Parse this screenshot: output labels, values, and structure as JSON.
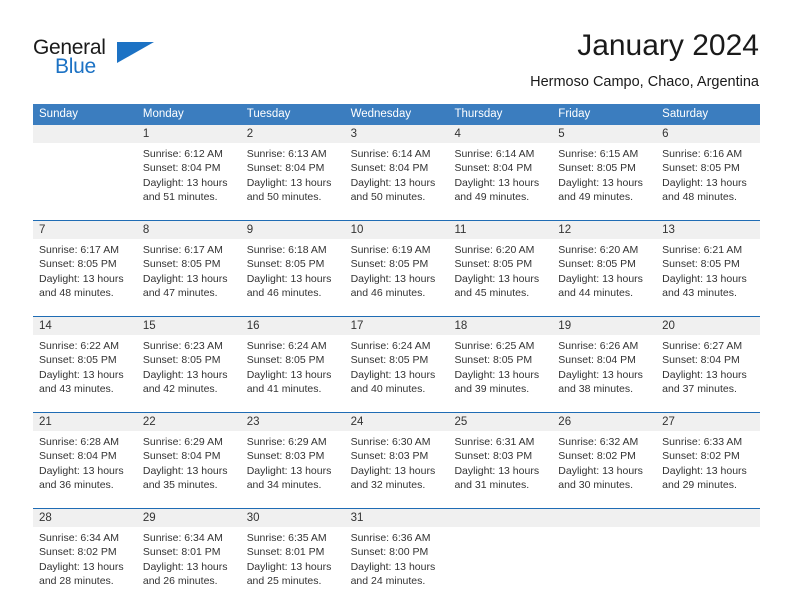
{
  "logo": {
    "word_top": "General",
    "word_bottom": "Blue",
    "accent_color": "#1c72c4"
  },
  "header": {
    "month_title": "January 2024",
    "location": "Hermoso Campo, Chaco, Argentina"
  },
  "calendar": {
    "header_color": "#3b7dbf",
    "day_names": [
      "Sunday",
      "Monday",
      "Tuesday",
      "Wednesday",
      "Thursday",
      "Friday",
      "Saturday"
    ],
    "weeks": [
      [
        {
          "day": "",
          "sunrise": "",
          "sunset": "",
          "daylight_line1": "",
          "daylight_line2": ""
        },
        {
          "day": "1",
          "sunrise": "Sunrise: 6:12 AM",
          "sunset": "Sunset: 8:04 PM",
          "daylight_line1": "Daylight: 13 hours",
          "daylight_line2": "and 51 minutes."
        },
        {
          "day": "2",
          "sunrise": "Sunrise: 6:13 AM",
          "sunset": "Sunset: 8:04 PM",
          "daylight_line1": "Daylight: 13 hours",
          "daylight_line2": "and 50 minutes."
        },
        {
          "day": "3",
          "sunrise": "Sunrise: 6:14 AM",
          "sunset": "Sunset: 8:04 PM",
          "daylight_line1": "Daylight: 13 hours",
          "daylight_line2": "and 50 minutes."
        },
        {
          "day": "4",
          "sunrise": "Sunrise: 6:14 AM",
          "sunset": "Sunset: 8:04 PM",
          "daylight_line1": "Daylight: 13 hours",
          "daylight_line2": "and 49 minutes."
        },
        {
          "day": "5",
          "sunrise": "Sunrise: 6:15 AM",
          "sunset": "Sunset: 8:05 PM",
          "daylight_line1": "Daylight: 13 hours",
          "daylight_line2": "and 49 minutes."
        },
        {
          "day": "6",
          "sunrise": "Sunrise: 6:16 AM",
          "sunset": "Sunset: 8:05 PM",
          "daylight_line1": "Daylight: 13 hours",
          "daylight_line2": "and 48 minutes."
        }
      ],
      [
        {
          "day": "7",
          "sunrise": "Sunrise: 6:17 AM",
          "sunset": "Sunset: 8:05 PM",
          "daylight_line1": "Daylight: 13 hours",
          "daylight_line2": "and 48 minutes."
        },
        {
          "day": "8",
          "sunrise": "Sunrise: 6:17 AM",
          "sunset": "Sunset: 8:05 PM",
          "daylight_line1": "Daylight: 13 hours",
          "daylight_line2": "and 47 minutes."
        },
        {
          "day": "9",
          "sunrise": "Sunrise: 6:18 AM",
          "sunset": "Sunset: 8:05 PM",
          "daylight_line1": "Daylight: 13 hours",
          "daylight_line2": "and 46 minutes."
        },
        {
          "day": "10",
          "sunrise": "Sunrise: 6:19 AM",
          "sunset": "Sunset: 8:05 PM",
          "daylight_line1": "Daylight: 13 hours",
          "daylight_line2": "and 46 minutes."
        },
        {
          "day": "11",
          "sunrise": "Sunrise: 6:20 AM",
          "sunset": "Sunset: 8:05 PM",
          "daylight_line1": "Daylight: 13 hours",
          "daylight_line2": "and 45 minutes."
        },
        {
          "day": "12",
          "sunrise": "Sunrise: 6:20 AM",
          "sunset": "Sunset: 8:05 PM",
          "daylight_line1": "Daylight: 13 hours",
          "daylight_line2": "and 44 minutes."
        },
        {
          "day": "13",
          "sunrise": "Sunrise: 6:21 AM",
          "sunset": "Sunset: 8:05 PM",
          "daylight_line1": "Daylight: 13 hours",
          "daylight_line2": "and 43 minutes."
        }
      ],
      [
        {
          "day": "14",
          "sunrise": "Sunrise: 6:22 AM",
          "sunset": "Sunset: 8:05 PM",
          "daylight_line1": "Daylight: 13 hours",
          "daylight_line2": "and 43 minutes."
        },
        {
          "day": "15",
          "sunrise": "Sunrise: 6:23 AM",
          "sunset": "Sunset: 8:05 PM",
          "daylight_line1": "Daylight: 13 hours",
          "daylight_line2": "and 42 minutes."
        },
        {
          "day": "16",
          "sunrise": "Sunrise: 6:24 AM",
          "sunset": "Sunset: 8:05 PM",
          "daylight_line1": "Daylight: 13 hours",
          "daylight_line2": "and 41 minutes."
        },
        {
          "day": "17",
          "sunrise": "Sunrise: 6:24 AM",
          "sunset": "Sunset: 8:05 PM",
          "daylight_line1": "Daylight: 13 hours",
          "daylight_line2": "and 40 minutes."
        },
        {
          "day": "18",
          "sunrise": "Sunrise: 6:25 AM",
          "sunset": "Sunset: 8:05 PM",
          "daylight_line1": "Daylight: 13 hours",
          "daylight_line2": "and 39 minutes."
        },
        {
          "day": "19",
          "sunrise": "Sunrise: 6:26 AM",
          "sunset": "Sunset: 8:04 PM",
          "daylight_line1": "Daylight: 13 hours",
          "daylight_line2": "and 38 minutes."
        },
        {
          "day": "20",
          "sunrise": "Sunrise: 6:27 AM",
          "sunset": "Sunset: 8:04 PM",
          "daylight_line1": "Daylight: 13 hours",
          "daylight_line2": "and 37 minutes."
        }
      ],
      [
        {
          "day": "21",
          "sunrise": "Sunrise: 6:28 AM",
          "sunset": "Sunset: 8:04 PM",
          "daylight_line1": "Daylight: 13 hours",
          "daylight_line2": "and 36 minutes."
        },
        {
          "day": "22",
          "sunrise": "Sunrise: 6:29 AM",
          "sunset": "Sunset: 8:04 PM",
          "daylight_line1": "Daylight: 13 hours",
          "daylight_line2": "and 35 minutes."
        },
        {
          "day": "23",
          "sunrise": "Sunrise: 6:29 AM",
          "sunset": "Sunset: 8:03 PM",
          "daylight_line1": "Daylight: 13 hours",
          "daylight_line2": "and 34 minutes."
        },
        {
          "day": "24",
          "sunrise": "Sunrise: 6:30 AM",
          "sunset": "Sunset: 8:03 PM",
          "daylight_line1": "Daylight: 13 hours",
          "daylight_line2": "and 32 minutes."
        },
        {
          "day": "25",
          "sunrise": "Sunrise: 6:31 AM",
          "sunset": "Sunset: 8:03 PM",
          "daylight_line1": "Daylight: 13 hours",
          "daylight_line2": "and 31 minutes."
        },
        {
          "day": "26",
          "sunrise": "Sunrise: 6:32 AM",
          "sunset": "Sunset: 8:02 PM",
          "daylight_line1": "Daylight: 13 hours",
          "daylight_line2": "and 30 minutes."
        },
        {
          "day": "27",
          "sunrise": "Sunrise: 6:33 AM",
          "sunset": "Sunset: 8:02 PM",
          "daylight_line1": "Daylight: 13 hours",
          "daylight_line2": "and 29 minutes."
        }
      ],
      [
        {
          "day": "28",
          "sunrise": "Sunrise: 6:34 AM",
          "sunset": "Sunset: 8:02 PM",
          "daylight_line1": "Daylight: 13 hours",
          "daylight_line2": "and 28 minutes."
        },
        {
          "day": "29",
          "sunrise": "Sunrise: 6:34 AM",
          "sunset": "Sunset: 8:01 PM",
          "daylight_line1": "Daylight: 13 hours",
          "daylight_line2": "and 26 minutes."
        },
        {
          "day": "30",
          "sunrise": "Sunrise: 6:35 AM",
          "sunset": "Sunset: 8:01 PM",
          "daylight_line1": "Daylight: 13 hours",
          "daylight_line2": "and 25 minutes."
        },
        {
          "day": "31",
          "sunrise": "Sunrise: 6:36 AM",
          "sunset": "Sunset: 8:00 PM",
          "daylight_line1": "Daylight: 13 hours",
          "daylight_line2": "and 24 minutes."
        },
        {
          "day": "",
          "sunrise": "",
          "sunset": "",
          "daylight_line1": "",
          "daylight_line2": ""
        },
        {
          "day": "",
          "sunrise": "",
          "sunset": "",
          "daylight_line1": "",
          "daylight_line2": ""
        },
        {
          "day": "",
          "sunrise": "",
          "sunset": "",
          "daylight_line1": "",
          "daylight_line2": ""
        }
      ]
    ]
  }
}
